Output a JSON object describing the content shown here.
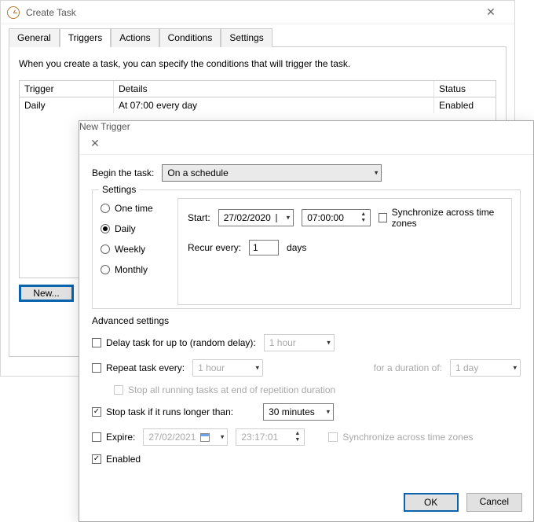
{
  "mainWindow": {
    "title": "Create Task",
    "tabs": [
      "General",
      "Triggers",
      "Actions",
      "Conditions",
      "Settings"
    ],
    "activeTab": "Triggers",
    "description": "When you create a task, you can specify the conditions that will trigger the task.",
    "columns": {
      "trigger": "Trigger",
      "details": "Details",
      "status": "Status"
    },
    "rows": [
      {
        "trigger": "Daily",
        "details": "At 07:00 every day",
        "status": "Enabled"
      }
    ],
    "buttons": {
      "new": "New..."
    }
  },
  "modal": {
    "title": "New Trigger",
    "beginLabel": "Begin the task:",
    "beginValue": "On a schedule",
    "settingsLegend": "Settings",
    "radios": {
      "once": "One time",
      "daily": "Daily",
      "weekly": "Weekly",
      "monthly": "Monthly"
    },
    "radioSelected": "daily",
    "startLabel": "Start:",
    "startDate": "27/02/2020",
    "startTime": "07:00:00",
    "syncTZ": "Synchronize across time zones",
    "recurLabel": "Recur every:",
    "recurValue": "1",
    "recurUnit": "days",
    "advLegend": "Advanced settings",
    "delayLabel": "Delay task for up to (random delay):",
    "delayValue": "1 hour",
    "repeatLabel": "Repeat task every:",
    "repeatValue": "1 hour",
    "repeatDurLabel": "for a duration of:",
    "repeatDurValue": "1 day",
    "stopAllLabel": "Stop all running tasks at end of repetition duration",
    "stopIfLabel": "Stop task if it runs longer than:",
    "stopIfValue": "30 minutes",
    "expireLabel": "Expire:",
    "expireDate": "27/02/2021",
    "expireTime": "23:17:01",
    "expireSyncTZ": "Synchronize across time zones",
    "enabledLabel": "Enabled",
    "ok": "OK",
    "cancel": "Cancel"
  }
}
